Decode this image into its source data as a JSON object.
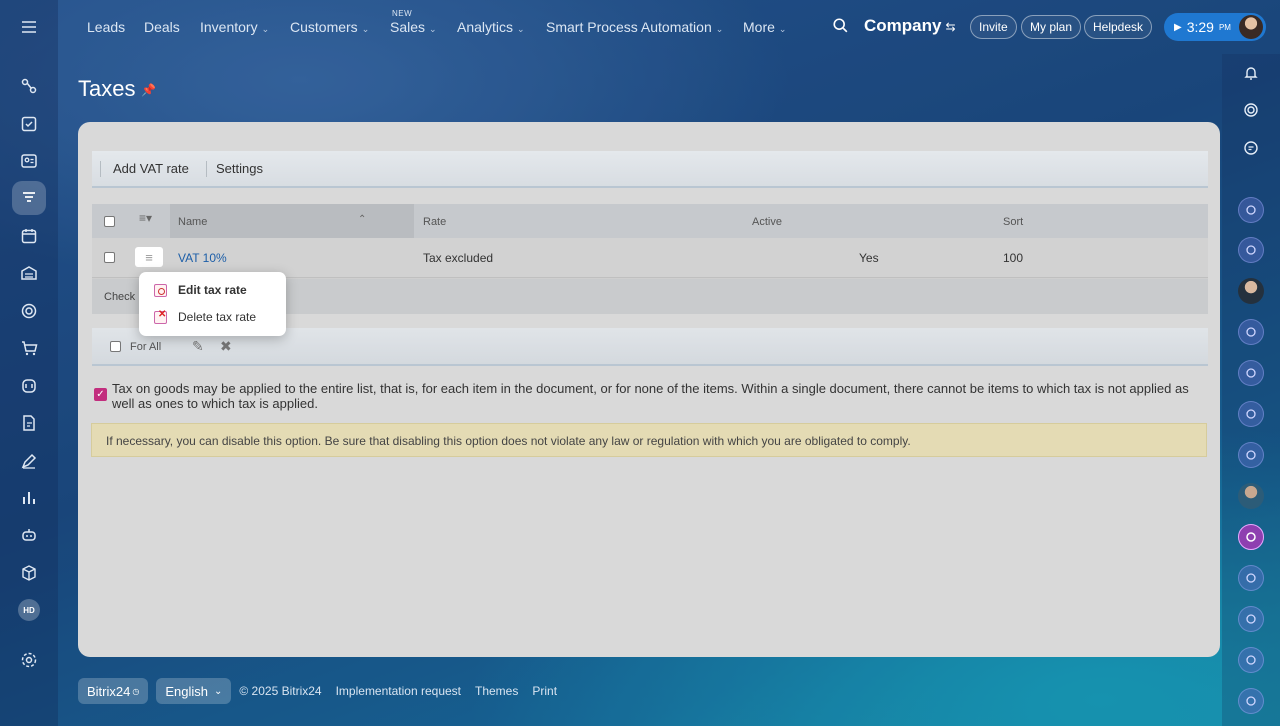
{
  "top_nav": {
    "items": [
      {
        "label": "Leads",
        "chevron": false
      },
      {
        "label": "Deals",
        "chevron": false
      },
      {
        "label": "Inventory",
        "chevron": true
      },
      {
        "label": "Customers",
        "chevron": true
      },
      {
        "label": "Sales",
        "chevron": true,
        "badge": "NEW"
      },
      {
        "label": "Analytics",
        "chevron": true
      },
      {
        "label": "Smart Process Automation",
        "chevron": true
      },
      {
        "label": "More",
        "chevron": true
      }
    ],
    "company": "Company",
    "invite": "Invite",
    "my_plan": "My plan",
    "helpdesk": "Helpdesk",
    "time": "3:29",
    "time_suffix": "PM"
  },
  "left_sidebar": {
    "hd_label": "HD"
  },
  "page": {
    "title": "Taxes"
  },
  "toolbar": {
    "add_vat": "Add VAT rate",
    "settings": "Settings"
  },
  "grid": {
    "columns": [
      "Name",
      "Rate",
      "Active",
      "Sort"
    ],
    "rows": [
      {
        "name": "VAT 10%",
        "rate": "Tax excluded",
        "active": "Yes",
        "sort": "100"
      }
    ],
    "footer_label": "Check"
  },
  "context_menu": {
    "edit": "Edit tax rate",
    "delete": "Delete tax rate"
  },
  "actions": {
    "for_all": "For All"
  },
  "tax_option": {
    "checked": true,
    "text": "Tax on goods may be applied to the entire list, that is, for each item in the document, or for none of the items. Within a single document, there cannot be items to which tax is not applied as well as ones to which tax is applied."
  },
  "warning": "If necessary, you can disable this option. Be sure that disabling this option does not violate any law or regulation with which you are obligated to comply.",
  "footer": {
    "brand": "Bitrix24",
    "language": "English",
    "copyright": "© 2025 Bitrix24",
    "implementation": "Implementation request",
    "themes": "Themes",
    "print": "Print"
  },
  "colors": {
    "accent_blue": "#1f78d1",
    "checkbox_pink": "#c22e7e",
    "link": "#1c5ea8",
    "warning_bg": "#e4dbb4"
  }
}
